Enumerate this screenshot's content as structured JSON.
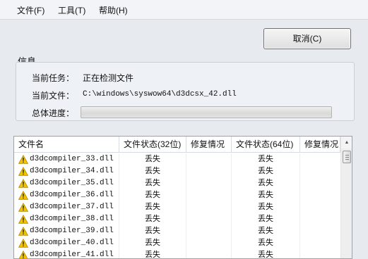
{
  "menu": {
    "file": "文件(F)",
    "tools": "工具(T)",
    "help": "帮助(H)"
  },
  "cancel_label": "取消(C)",
  "info": {
    "title": "信息",
    "task_label": "当前任务：",
    "task_value": "正在检测文件",
    "file_label": "当前文件：",
    "file_value": "C:\\windows\\syswow64\\d3dcsx_42.dll",
    "progress_label": "总体进度：",
    "progress_fraction": 0.0
  },
  "table": {
    "columns": [
      "文件名",
      "文件状态(32位)",
      "修复情况",
      "文件状态(64位)",
      "修复情况"
    ],
    "rows": [
      {
        "name": "d3dcompiler_33.dll",
        "status32": "丢失",
        "fix32": "",
        "status64": "丢失",
        "fix64": ""
      },
      {
        "name": "d3dcompiler_34.dll",
        "status32": "丢失",
        "fix32": "",
        "status64": "丢失",
        "fix64": ""
      },
      {
        "name": "d3dcompiler_35.dll",
        "status32": "丢失",
        "fix32": "",
        "status64": "丢失",
        "fix64": ""
      },
      {
        "name": "d3dcompiler_36.dll",
        "status32": "丢失",
        "fix32": "",
        "status64": "丢失",
        "fix64": ""
      },
      {
        "name": "d3dcompiler_37.dll",
        "status32": "丢失",
        "fix32": "",
        "status64": "丢失",
        "fix64": ""
      },
      {
        "name": "d3dcompiler_38.dll",
        "status32": "丢失",
        "fix32": "",
        "status64": "丢失",
        "fix64": ""
      },
      {
        "name": "d3dcompiler_39.dll",
        "status32": "丢失",
        "fix32": "",
        "status64": "丢失",
        "fix64": ""
      },
      {
        "name": "d3dcompiler_40.dll",
        "status32": "丢失",
        "fix32": "",
        "status64": "丢失",
        "fix64": ""
      },
      {
        "name": "d3dcompiler_41.dll",
        "status32": "丢失",
        "fix32": "",
        "status64": "丢失",
        "fix64": ""
      }
    ]
  },
  "icons": {
    "row_icon": "warning-icon",
    "scroll_up": "scroll-up-arrow-icon"
  },
  "colors": {
    "warning_fill": "#f5c400",
    "progress_green": "#3db33d"
  }
}
